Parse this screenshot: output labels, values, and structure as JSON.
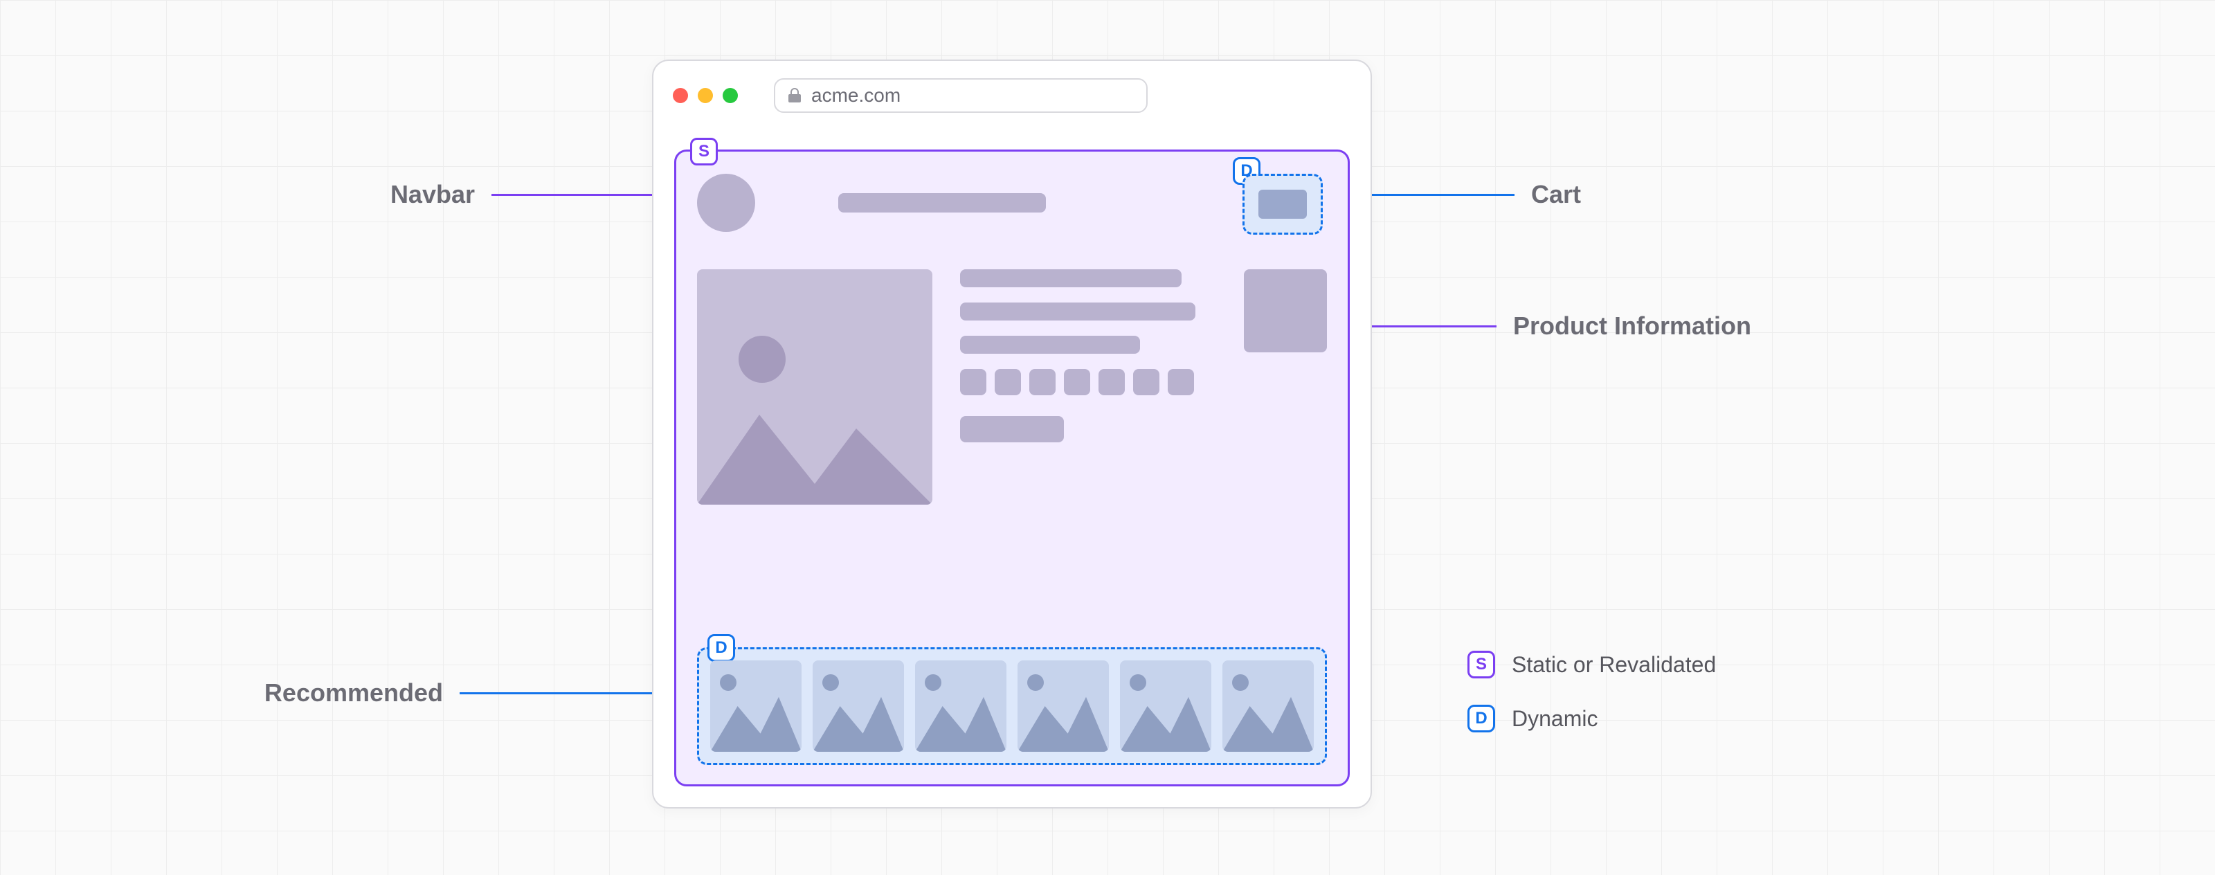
{
  "browser": {
    "url": "acme.com"
  },
  "labels": {
    "navbar": "Navbar",
    "cart": "Cart",
    "product_info": "Product Information",
    "recommended": "Recommended"
  },
  "badges": {
    "static": "S",
    "dynamic": "D"
  },
  "legend": {
    "static": "Static or Revalidated",
    "dynamic": "Dynamic"
  },
  "colors": {
    "static": "#7b3ff2",
    "dynamic": "#1273eb"
  },
  "recommended_count": 6,
  "swatch_count": 7
}
